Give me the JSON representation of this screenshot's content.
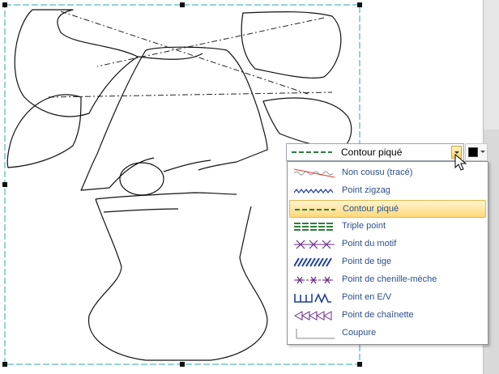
{
  "stitch_combo": {
    "selected_label": "Contour piqué",
    "swatch_color": "#2e7d3a"
  },
  "color_combo": {
    "color": "#000000"
  },
  "stitch_list": {
    "items": [
      {
        "label": "Non cousu (tracé)",
        "icon": "no-sew-icon"
      },
      {
        "label": "Point zigzag",
        "icon": "zigzag-stitch-icon"
      },
      {
        "label": "Contour piqué",
        "icon": "running-stitch-icon",
        "selected": true
      },
      {
        "label": "Triple point",
        "icon": "triple-stitch-icon"
      },
      {
        "label": "Point du motif",
        "icon": "motif-stitch-icon"
      },
      {
        "label": "Point de tige",
        "icon": "stem-stitch-icon"
      },
      {
        "label": "Point de chenille-mèche",
        "icon": "candlewicking-stitch-icon"
      },
      {
        "label": "Point en E/V",
        "icon": "ev-stitch-icon"
      },
      {
        "label": "Point de chaînette",
        "icon": "chain-stitch-icon"
      },
      {
        "label": "Coupure",
        "icon": "cut-icon"
      }
    ]
  },
  "colors": {
    "selection_frame": "#2aa8a8",
    "accent_green": "#2e7d3a",
    "stitch_blue": "#1f3f9a",
    "stitch_purple": "#6b2a8a",
    "highlight": "#ffd87a"
  }
}
